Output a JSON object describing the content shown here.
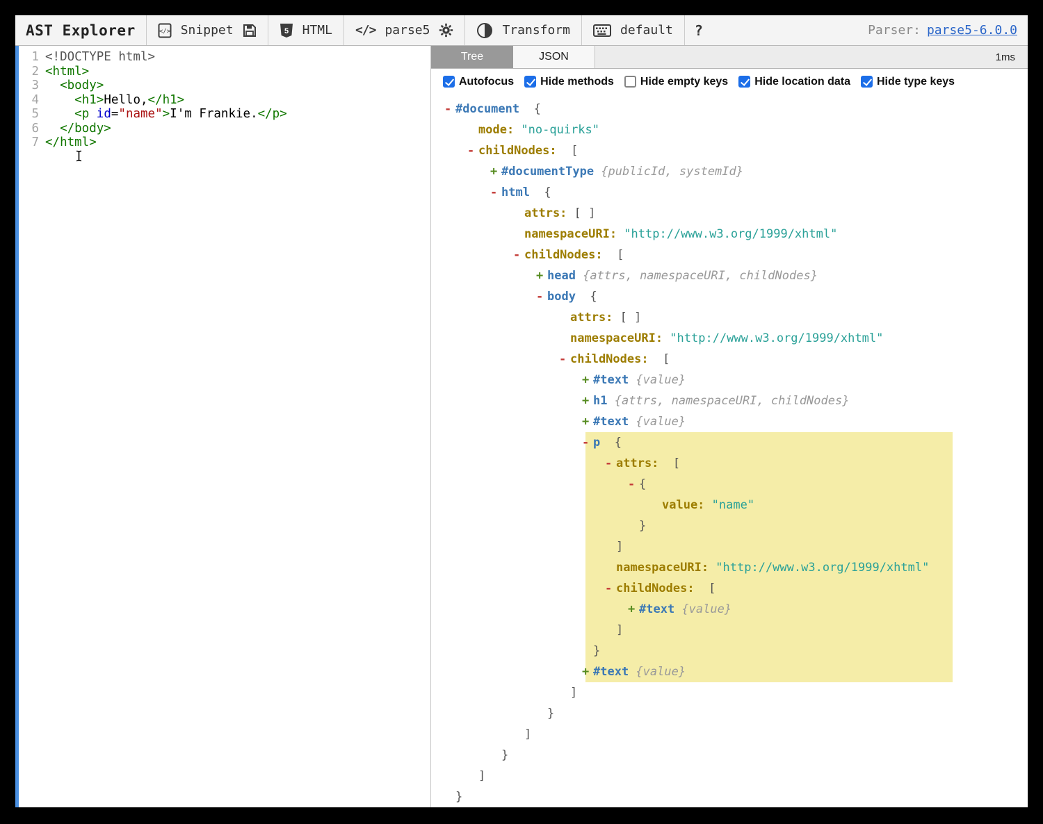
{
  "colors": {
    "accent_strip": "#4a90e2",
    "highlight": "#f5eda8",
    "checkbox_blue": "#1c6ee8",
    "link_blue": "#2b66c9",
    "node_blue": "#3b78b5",
    "key_olive": "#9d7d00",
    "string_teal": "#2aa198",
    "collapse_red": "#c43c39",
    "expand_green": "#558b1f"
  },
  "toolbar": {
    "title": "AST Explorer",
    "snippet_label": "Snippet",
    "html_label": "HTML",
    "parser_icon_text": "</>",
    "parser_name": "parse5",
    "transform_label": "Transform",
    "keymap_label": "default",
    "help_label": "?",
    "parser_info_label": "Parser:",
    "parser_version_link": "parse5-6.0.0",
    "icons": [
      "code-file-icon",
      "save-icon",
      "html5-shield-icon",
      "code-brackets-icon",
      "gear-icon",
      "toggle-contrast-icon",
      "keyboard-icon",
      "question-mark"
    ]
  },
  "editor": {
    "lines": [
      {
        "num": "1",
        "t": [
          [
            "meta",
            "<!DOCTYPE html>"
          ]
        ]
      },
      {
        "num": "2",
        "t": [
          [
            "tag",
            "<html>"
          ]
        ]
      },
      {
        "num": "3",
        "t": [
          [
            "pln",
            "  "
          ],
          [
            "tag",
            "<body>"
          ]
        ]
      },
      {
        "num": "4",
        "t": [
          [
            "pln",
            "    "
          ],
          [
            "tag",
            "<h1>"
          ],
          [
            "pln",
            "Hello,"
          ],
          [
            "tag",
            "</h1>"
          ]
        ]
      },
      {
        "num": "5",
        "t": [
          [
            "pln",
            "    "
          ],
          [
            "tag",
            "<p"
          ],
          [
            "pln",
            " "
          ],
          [
            "attr",
            "id"
          ],
          [
            "pln",
            "="
          ],
          [
            "str",
            "\"name\""
          ],
          [
            "tag",
            ">"
          ],
          [
            "pln",
            "I'm Frankie."
          ],
          [
            "tag",
            "</p>"
          ]
        ]
      },
      {
        "num": "6",
        "t": [
          [
            "pln",
            "  "
          ],
          [
            "tag",
            "</body>"
          ]
        ]
      },
      {
        "num": "7",
        "t": [
          [
            "tag",
            "</html>"
          ]
        ]
      }
    ]
  },
  "ast": {
    "tabs": {
      "tree": "Tree",
      "json": "JSON"
    },
    "timing": "1ms",
    "options": [
      {
        "label": "Autofocus",
        "checked": true
      },
      {
        "label": "Hide methods",
        "checked": true
      },
      {
        "label": "Hide empty keys",
        "checked": false
      },
      {
        "label": "Hide location data",
        "checked": true
      },
      {
        "label": "Hide type keys",
        "checked": true
      }
    ],
    "tree": [
      {
        "i": 0,
        "e": "-",
        "t": [
          [
            "node",
            "#document"
          ],
          [
            "brk",
            "  {"
          ]
        ]
      },
      {
        "i": 1,
        "t": [
          [
            "key",
            "mode:"
          ],
          [
            "str",
            " \"no-quirks\""
          ]
        ]
      },
      {
        "i": 1,
        "e": "-",
        "t": [
          [
            "key",
            "childNodes:"
          ],
          [
            "brk",
            "  ["
          ]
        ]
      },
      {
        "i": 2,
        "e": "+",
        "t": [
          [
            "node",
            "#documentType"
          ],
          [
            "meta",
            " {publicId, systemId}"
          ]
        ]
      },
      {
        "i": 2,
        "e": "-",
        "t": [
          [
            "node",
            "html"
          ],
          [
            "brk",
            "  {"
          ]
        ]
      },
      {
        "i": 3,
        "t": [
          [
            "key",
            "attrs:"
          ],
          [
            "brk",
            " [ ]"
          ]
        ]
      },
      {
        "i": 3,
        "t": [
          [
            "key",
            "namespaceURI:"
          ],
          [
            "str",
            " \"http://www.w3.org/1999/xhtml\""
          ]
        ]
      },
      {
        "i": 3,
        "e": "-",
        "t": [
          [
            "key",
            "childNodes:"
          ],
          [
            "brk",
            "  ["
          ]
        ]
      },
      {
        "i": 4,
        "e": "+",
        "t": [
          [
            "node",
            "head"
          ],
          [
            "meta",
            " {attrs, namespaceURI, childNodes}"
          ]
        ]
      },
      {
        "i": 4,
        "e": "-",
        "t": [
          [
            "node",
            "body"
          ],
          [
            "brk",
            "  {"
          ]
        ]
      },
      {
        "i": 5,
        "t": [
          [
            "key",
            "attrs:"
          ],
          [
            "brk",
            " [ ]"
          ]
        ]
      },
      {
        "i": 5,
        "t": [
          [
            "key",
            "namespaceURI:"
          ],
          [
            "str",
            " \"http://www.w3.org/1999/xhtml\""
          ]
        ]
      },
      {
        "i": 5,
        "e": "-",
        "t": [
          [
            "key",
            "childNodes:"
          ],
          [
            "brk",
            "  ["
          ]
        ]
      },
      {
        "i": 6,
        "e": "+",
        "t": [
          [
            "node",
            "#text"
          ],
          [
            "meta",
            " {value}"
          ]
        ]
      },
      {
        "i": 6,
        "e": "+",
        "t": [
          [
            "node",
            "h1"
          ],
          [
            "meta",
            " {attrs, namespaceURI, childNodes}"
          ]
        ]
      },
      {
        "i": 6,
        "e": "+",
        "t": [
          [
            "node",
            "#text"
          ],
          [
            "meta",
            " {value}"
          ]
        ]
      },
      {
        "i": 6,
        "e": "-",
        "hl": true,
        "t": [
          [
            "node",
            "p"
          ],
          [
            "brk",
            "  {"
          ]
        ]
      },
      {
        "i": 7,
        "e": "-",
        "hl": true,
        "t": [
          [
            "key",
            "attrs:"
          ],
          [
            "brk",
            "  ["
          ]
        ]
      },
      {
        "i": 8,
        "e": "-",
        "hl": true,
        "t": [
          [
            "brk",
            "{"
          ]
        ]
      },
      {
        "i": 9,
        "hl": true,
        "t": [
          [
            "key",
            "value:"
          ],
          [
            "str",
            " \"name\""
          ]
        ]
      },
      {
        "i": 8,
        "hl": true,
        "t": [
          [
            "brk",
            "}"
          ]
        ]
      },
      {
        "i": 7,
        "hl": true,
        "t": [
          [
            "brk",
            "]"
          ]
        ]
      },
      {
        "i": 7,
        "hl": true,
        "t": [
          [
            "key",
            "namespaceURI:"
          ],
          [
            "str",
            " \"http://www.w3.org/1999/xhtml\""
          ]
        ]
      },
      {
        "i": 7,
        "e": "-",
        "hl": true,
        "t": [
          [
            "key",
            "childNodes:"
          ],
          [
            "brk",
            "  ["
          ]
        ]
      },
      {
        "i": 8,
        "e": "+",
        "hl": true,
        "t": [
          [
            "node",
            "#text"
          ],
          [
            "meta",
            " {value}"
          ]
        ]
      },
      {
        "i": 7,
        "hl": true,
        "t": [
          [
            "brk",
            "]"
          ]
        ]
      },
      {
        "i": 6,
        "hl": true,
        "t": [
          [
            "brk",
            "}"
          ]
        ]
      },
      {
        "i": 6,
        "e": "+",
        "hl": true,
        "t": [
          [
            "node",
            "#text"
          ],
          [
            "meta",
            " {value}"
          ]
        ]
      },
      {
        "i": 5,
        "t": [
          [
            "brk",
            "]"
          ]
        ]
      },
      {
        "i": 4,
        "t": [
          [
            "brk",
            "}"
          ]
        ]
      },
      {
        "i": 3,
        "t": [
          [
            "brk",
            "]"
          ]
        ]
      },
      {
        "i": 2,
        "t": [
          [
            "brk",
            "}"
          ]
        ]
      },
      {
        "i": 1,
        "t": [
          [
            "brk",
            "]"
          ]
        ]
      },
      {
        "i": 0,
        "t": [
          [
            "brk",
            "}"
          ]
        ]
      }
    ]
  }
}
